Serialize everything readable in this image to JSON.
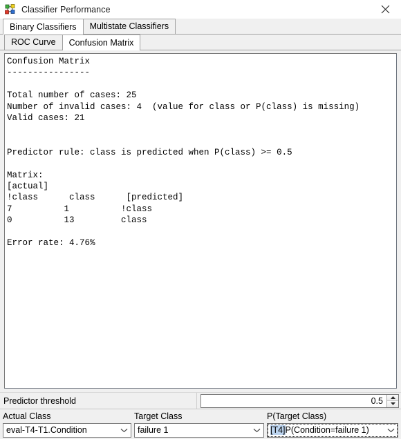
{
  "window": {
    "title": "Classifier Performance",
    "icon": "network-graph-icon",
    "close_label": "✕"
  },
  "outer_tabs": [
    {
      "label": "Binary Classifiers",
      "selected": true
    },
    {
      "label": "Multistate Classifiers",
      "selected": false
    }
  ],
  "inner_tabs": [
    {
      "label": "ROC Curve",
      "selected": false
    },
    {
      "label": "Confusion Matrix",
      "selected": true
    }
  ],
  "report": {
    "text": "Confusion Matrix\n----------------\n\nTotal number of cases: 25\nNumber of invalid cases: 4  (value for class or P(class) is missing)\nValid cases: 21\n\n\nPredictor rule: class is predicted when P(class) >= 0.5\n\nMatrix:\n[actual]\n!class      class      [predicted]\n7          1          !class\n0          13         class\n\nError rate: 4.76%",
    "title": "Confusion Matrix",
    "underline": "----------------",
    "total_cases_label": "Total number of cases:",
    "total_cases": "25",
    "invalid_cases_label": "Number of invalid cases:",
    "invalid_cases": "4",
    "invalid_note": "(value for class or P(class) is missing)",
    "valid_cases_label": "Valid cases:",
    "valid_cases": "21",
    "predictor_rule": "Predictor rule: class is predicted when P(class) >= 0.5",
    "matrix_label": "Matrix:",
    "actual_header": "[actual]",
    "matrix_columns": [
      "!class",
      "class",
      "[predicted]"
    ],
    "matrix_rows": [
      {
        "not_class": "7",
        "class": "1",
        "predicted": "!class"
      },
      {
        "not_class": "0",
        "class": "13",
        "predicted": "class"
      }
    ],
    "error_rate_label": "Error rate:",
    "error_rate": "4.76%"
  },
  "threshold": {
    "label": "Predictor threshold",
    "value": "0.5",
    "up_arrow": "▲",
    "down_arrow": "▼"
  },
  "selectors": {
    "actual_class": {
      "label": "Actual Class",
      "value": "eval-T4-T1.Condition"
    },
    "target_class": {
      "label": "Target Class",
      "value": "failure 1"
    },
    "p_target_class": {
      "label": "P(Target Class)",
      "value_highlighted": "[T4]",
      "value_rest": "P(Condition=failure 1)",
      "value": "[T4]P(Condition=failure 1)",
      "focused": true
    }
  },
  "colors": {
    "window_bg": "#ffffff",
    "chrome_bg": "#f0f0f0",
    "border": "#a0a0a0",
    "text": "#000000",
    "selection_highlight": "#bcd4ef",
    "field_border": "#7a7a7a"
  }
}
